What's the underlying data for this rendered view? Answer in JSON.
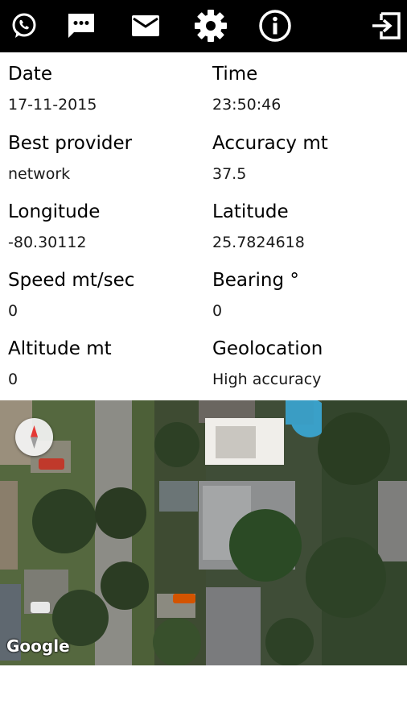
{
  "toolbar": {
    "buttons": [
      {
        "icon": "whatsapp-icon"
      },
      {
        "icon": "sms-icon"
      },
      {
        "icon": "email-icon"
      },
      {
        "icon": "settings-icon"
      },
      {
        "icon": "info-icon"
      },
      {
        "icon": "exit-icon"
      }
    ]
  },
  "info": {
    "date": {
      "label": "Date",
      "value": "17-11-2015"
    },
    "time": {
      "label": "Time",
      "value": "23:50:46"
    },
    "best_provider": {
      "label": "Best provider",
      "value": "network"
    },
    "accuracy": {
      "label": "Accuracy mt",
      "value": "37.5"
    },
    "longitude": {
      "label": "Longitude",
      "value": "-80.30112"
    },
    "latitude": {
      "label": "Latitude",
      "value": "25.7824618"
    },
    "speed": {
      "label": "Speed mt/sec",
      "value": "0"
    },
    "bearing": {
      "label": "Bearing °",
      "value": "0"
    },
    "altitude": {
      "label": "Altitude mt",
      "value": "0"
    },
    "geolocation": {
      "label": "Geolocation",
      "value": "High accuracy"
    }
  },
  "map": {
    "attribution": "Google",
    "type": "satellite"
  },
  "colors": {
    "toolbar_bg": "#000000",
    "toolbar_icon": "#ffffff",
    "compass_needle": "#e53935"
  }
}
